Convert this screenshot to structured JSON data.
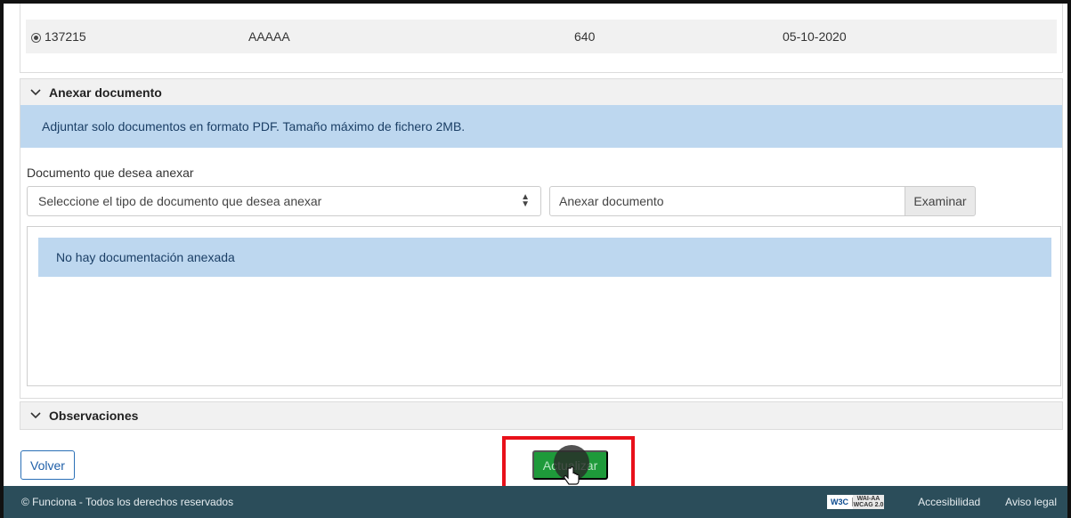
{
  "table": {
    "row": {
      "id": "137215",
      "name": "AAAAA",
      "amount": "640",
      "date": "05-10-2020"
    }
  },
  "attach_section": {
    "title": "Anexar documento",
    "info": "Adjuntar solo documentos en formato PDF. Tamaño máximo de fichero 2MB.",
    "field_label": "Documento que desea anexar",
    "select_placeholder": "Seleccione el tipo de documento que desea anexar",
    "file_placeholder": "Anexar documento",
    "browse_label": "Examinar",
    "empty_message": "No hay documentación anexada"
  },
  "observations_section": {
    "title": "Observaciones"
  },
  "actions": {
    "back_label": "Volver",
    "update_label": "Actualizar"
  },
  "footer": {
    "copyright": "© Funciona - Todos los derechos reservados",
    "badge_w3c": "W3C",
    "badge_wai_1": "WAI-AA",
    "badge_wai_2": "WCAG 2.0",
    "accessibility": "Accesibilidad",
    "legal": "Aviso legal"
  },
  "colors": {
    "info_bg": "#bdd7ef",
    "update_button": "#1e9a3a",
    "footer_bg": "#2b4d5a",
    "highlight": "#e8101a"
  }
}
